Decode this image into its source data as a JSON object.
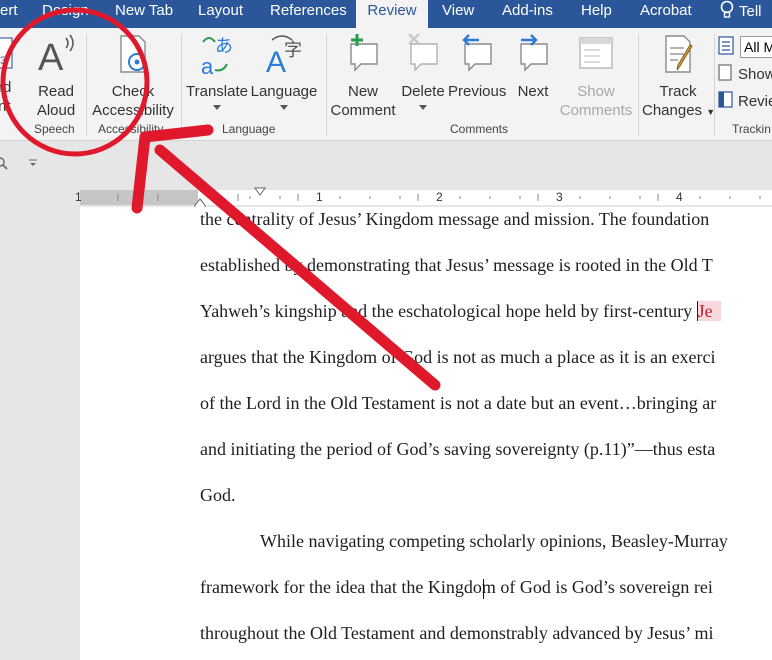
{
  "tabs": [
    "ert",
    "Design",
    "New Tab",
    "Layout",
    "References",
    "Review",
    "View",
    "Add-ins",
    "Help",
    "Acrobat",
    "Tell"
  ],
  "active_tab": "Review",
  "ribbon": {
    "word_count_partial": [
      "rd",
      "nt"
    ],
    "read_aloud": [
      "Read",
      "Aloud"
    ],
    "check_accessibility": [
      "Check",
      "Accessibility"
    ],
    "translate": "Translate",
    "language": "Language",
    "new_comment": [
      "New",
      "Comment"
    ],
    "delete": "Delete",
    "previous": "Previous",
    "next": "Next",
    "show_comments": [
      "Show",
      "Comments"
    ],
    "track_changes": [
      "Track",
      "Changes"
    ],
    "markup_select": "All M",
    "show_markup": "Show",
    "reviewing_pane": "Revie",
    "groups": {
      "speech": "Speech",
      "accessibility": "Accessibility",
      "language": "Language",
      "comments": "Comments",
      "tracking": "Trackin"
    }
  },
  "ruler_numbers": [
    "1",
    "1",
    "2",
    "3",
    "4"
  ],
  "document_lines": [
    "the centrality of Jesus’ Kingdom message and mission. The foundation",
    "established by demonstrating that Jesus’ message is rooted in the Old T",
    "Yahweh’s kingship and the eschatological hope held by first-century ",
    "argues that the Kingdom of God is not as much a place as it is an exerci",
    "of the Lord in the Old Testament is not a date but an event…bringing ar",
    "and initiating the period of God’s saving sovereignty (p.11)”—thus esta",
    "God.",
    "While navigating competing scholarly opinions, Beasley-Murray",
    "framework for the idea that the Kingdom of God is God’s sovereign rei",
    "throughout the Old Testament and demonstrably advanced by Jesus’ mi"
  ],
  "flagged_word": "Je",
  "colors": {
    "title_bar": "#2b579a",
    "ribbon_bg": "#f3f3f3",
    "annotation": "#e0182c",
    "flag_highlight": "#f8d8dc"
  }
}
